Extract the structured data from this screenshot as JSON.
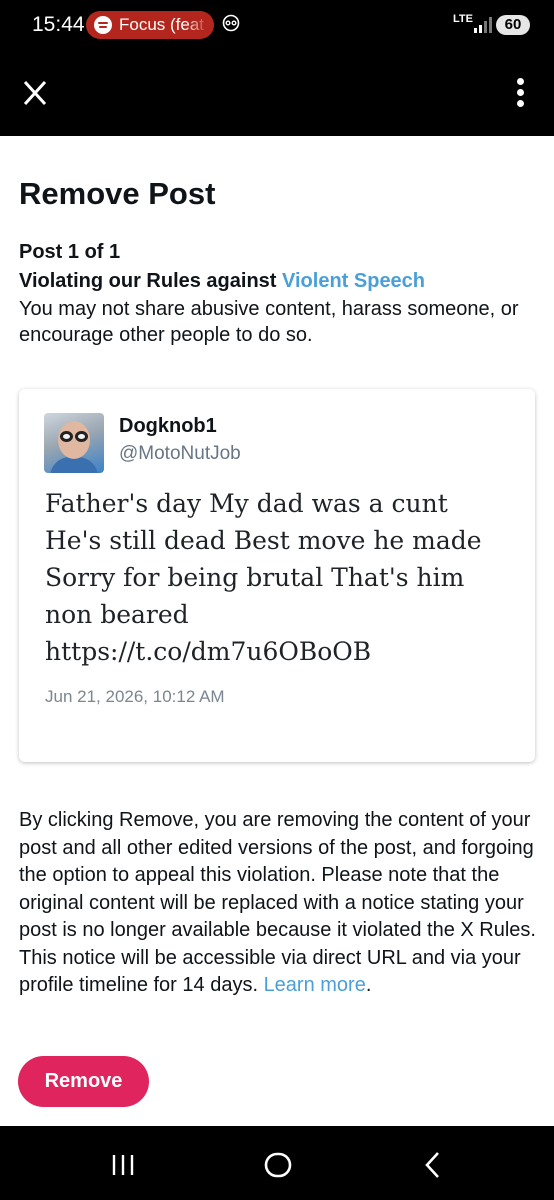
{
  "status_bar": {
    "time": "15:44",
    "media_pill": "Focus (feat",
    "network": "LTE",
    "battery": "60",
    "icons": [
      "spotify-icon",
      "do-not-disturb-icon",
      "signal-icon",
      "battery-icon"
    ]
  },
  "app_bar": {
    "close_icon": "close-icon",
    "menu_icon": "more-vertical-icon"
  },
  "page": {
    "title": "Remove Post",
    "post_count": "Post 1 of 1",
    "rule_prefix": "Violating our Rules against ",
    "rule_link": "Violent Speech",
    "rule_description": "You may not share abusive content, harass someone, or encourage other people to do so."
  },
  "post": {
    "display_name": "Dogknob1",
    "handle": "@MotoNutJob",
    "text": "Father's day My dad was a cunt\nHe's still dead Best move he made\nSorry for being brutal That's him\nnon beared\nhttps://t.co/dm7u6OBoOB",
    "date": "Jun 21, 2026, 10:12 AM"
  },
  "notice": {
    "body": "By clicking Remove, you are removing the content of your post and all other edited versions of the post, and forgoing the option to appeal this violation. Please note that the original content will be replaced with a notice stating your post is no longer available because it violated the X Rules. This notice will be accessible via direct URL and via your profile timeline for 14 days. ",
    "link": "Learn more",
    "trailing": "."
  },
  "actions": {
    "remove_label": "Remove"
  },
  "colors": {
    "link": "#4a9fd8",
    "remove_button": "#e0245e",
    "bars": "#000000"
  },
  "nav_bar": {
    "icons": [
      "recents-icon",
      "home-icon",
      "back-icon"
    ]
  }
}
